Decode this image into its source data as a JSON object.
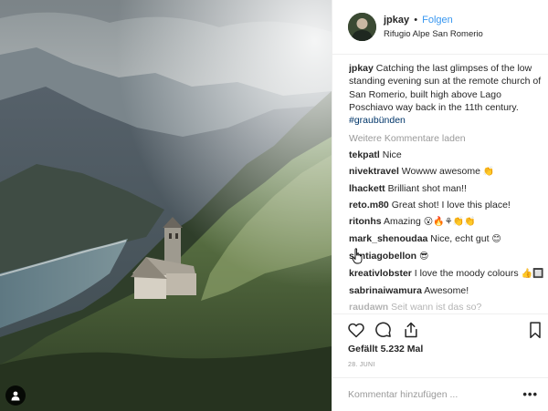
{
  "header": {
    "username": "jpkay",
    "separator": "•",
    "follow_label": "Folgen",
    "location": "Rifugio Alpe San Romerio"
  },
  "caption": {
    "username": "jpkay",
    "text": "Catching the last glimpses of the low standing evening sun at the remote church of San Romerio, built high above Lago Poschiavo way back in the 11th century.",
    "hashtag": "#graubünden"
  },
  "load_more_label": "Weitere Kommentare laden",
  "comments": [
    {
      "user": "tekpatl",
      "text": "Nice",
      "emoji": ""
    },
    {
      "user": "nivektravel",
      "text": "Wowww awesome",
      "emoji": "👏"
    },
    {
      "user": "lhackett",
      "text": "Brilliant shot man!!",
      "emoji": ""
    },
    {
      "user": "reto.m80",
      "text": "Great shot! I love this place!",
      "emoji": ""
    },
    {
      "user": "ritonhs",
      "text": "Amazing",
      "emoji": "😮🔥⚘👏👏"
    },
    {
      "user": "mark_shenoudaa",
      "text": "Nice, echt gut",
      "emoji": "😊"
    },
    {
      "user": "santiagobellon",
      "text": "",
      "emoji": "😎"
    },
    {
      "user": "kreativlobster",
      "text": "I love the moody colours",
      "emoji": "👍🔲"
    },
    {
      "user": "sabrinaiwamura",
      "text": "Awesome!",
      "emoji": ""
    },
    {
      "user": "raudawn",
      "text": "Seit wann ist das so?",
      "emoji": ""
    }
  ],
  "likes_label": "Gefällt 5.232 Mal",
  "date_label": "28. JUNI",
  "add_comment": {
    "placeholder": "Kommentar hinzufügen ...",
    "more_label": "•••"
  },
  "icons": {
    "like": "heart-icon",
    "comment": "speech-bubble-icon",
    "share": "share-icon",
    "save": "bookmark-icon",
    "tag": "user-tag-icon"
  },
  "colors": {
    "link_blue": "#3897f0",
    "hashtag": "#003569",
    "muted": "#999999",
    "text": "#262626",
    "border": "#efefef"
  }
}
